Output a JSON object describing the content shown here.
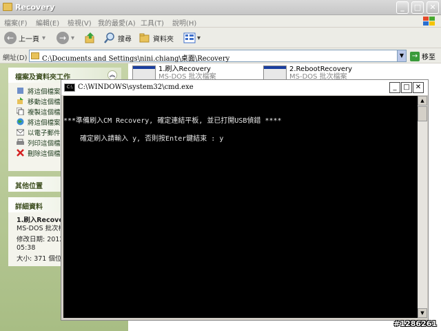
{
  "explorer": {
    "title": "Recovery",
    "menu": [
      "檔案(F)",
      "編輯(E)",
      "檢視(V)",
      "我的最愛(A)",
      "工具(T)",
      "說明(H)"
    ],
    "toolbar": {
      "back_label": "上一頁",
      "search_label": "搜尋",
      "folders_label": "資料夾"
    },
    "address": {
      "label": "網址(D)",
      "path": "C:\\Documents and Settings\\nini.chiang\\桌面\\Recovery",
      "go_label": "移至"
    },
    "taskpane": {
      "file_tasks": {
        "title": "檔案及資料夾工作",
        "items": [
          "將這個檔案",
          "移動這個檔",
          "複製這個檔",
          "將這個檔案",
          "以電子郵件",
          "列印這個檔",
          "刪除這個檔"
        ]
      },
      "other_places": {
        "title": "其他位置"
      },
      "details": {
        "title": "詳細資料",
        "name": "1.刷入Recove",
        "type": "MS-DOS 批次檔",
        "modified": "修改日期: 2012",
        "time": "05:38",
        "size": "大小: 371 個位元"
      }
    },
    "files": [
      {
        "name": "1.刷入Recovery",
        "type": "MS-DOS 批次檔案"
      },
      {
        "name": "2.RebootRecovery",
        "type": "MS-DOS 批次檔案"
      }
    ]
  },
  "cmd": {
    "title": "C:\\WINDOWS\\system32\\cmd.exe",
    "line1": "***準備刷入CM Recovery, 確定連結平板, 並已打開USB偵錯 ****",
    "line2": "    確定刷入請輸入 y, 否則按Enter鍵結束 : y"
  },
  "watermark": "#1286261",
  "colors": {
    "console_bg": "#000000",
    "taskpane_bg": "#b8c994"
  }
}
